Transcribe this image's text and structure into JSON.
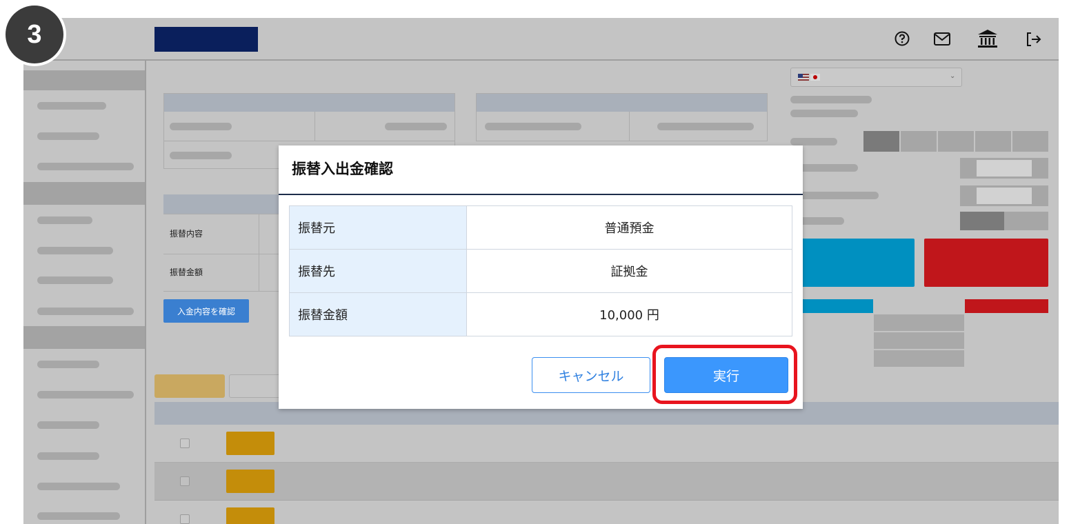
{
  "header": {
    "icons": [
      "help-icon",
      "mail-icon",
      "bank-icon",
      "logout-icon"
    ]
  },
  "step_badge": "3",
  "background_form": {
    "row1_label": "振替内容",
    "row2_label": "振替金額",
    "confirm_button": "入金内容を確認"
  },
  "dialog": {
    "title": "振替入出金確認",
    "rows": [
      {
        "label": "振替元",
        "value": "普通預金"
      },
      {
        "label": "振替先",
        "value": "証拠金"
      },
      {
        "label": "振替金額",
        "value": "10,000 円"
      }
    ],
    "cancel_label": "キャンセル",
    "execute_label": "実行"
  },
  "colors": {
    "accent": "#3b97fd",
    "highlight": "#e8141e",
    "header_logo": "#0a1f5c",
    "buy": "#0090c0",
    "sell": "#c0161b"
  }
}
